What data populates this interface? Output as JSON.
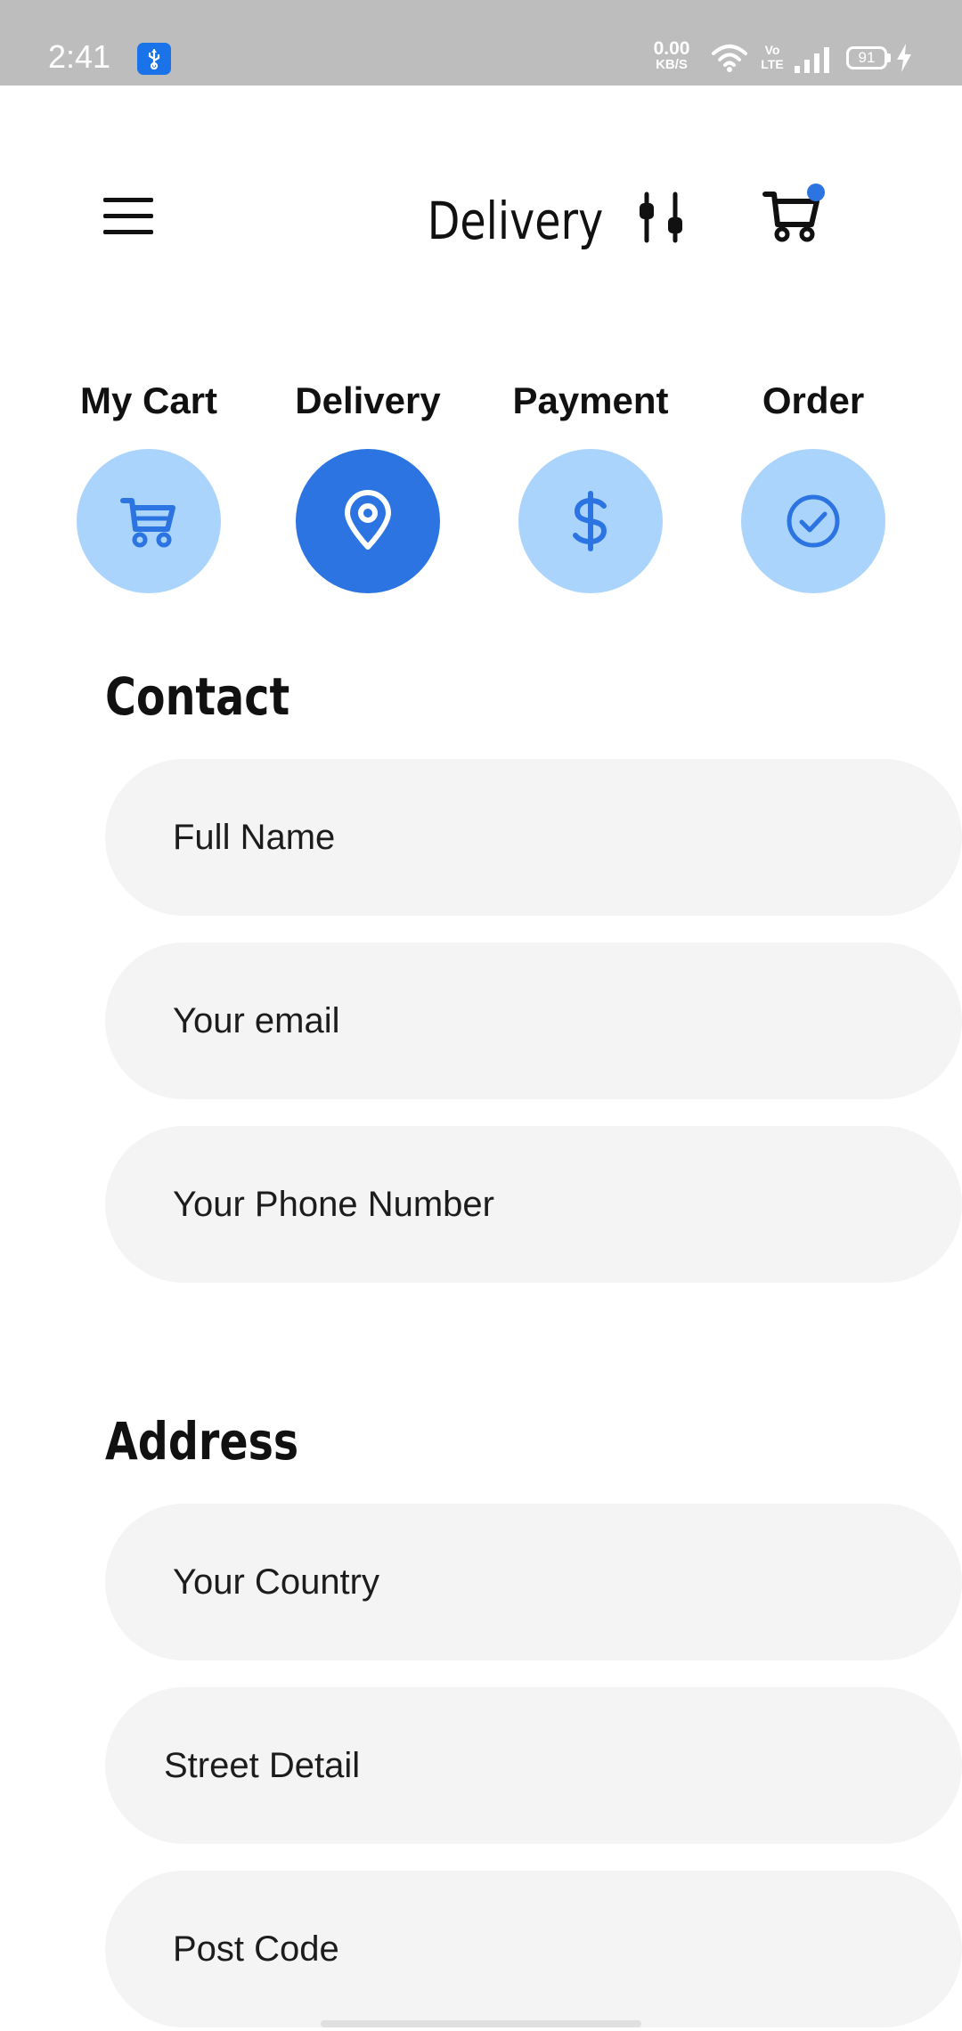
{
  "status_bar": {
    "time": "2:41",
    "net_speed_value": "0.00",
    "net_speed_unit": "KB/S",
    "volte_label": "Vo LTE",
    "battery_level": "91"
  },
  "app_bar": {
    "title": "Delivery",
    "icons": [
      "menu-icon",
      "filter-icon",
      "cart-icon"
    ],
    "cart_badge_color": "#2b74e2"
  },
  "steps": [
    {
      "label": "My Cart",
      "icon": "cart-icon",
      "active": false
    },
    {
      "label": "Delivery",
      "icon": "location-pin-icon",
      "active": true
    },
    {
      "label": "Payment",
      "icon": "dollar-icon",
      "active": false
    },
    {
      "label": "Order",
      "icon": "check-circle-icon",
      "active": false
    }
  ],
  "colors": {
    "accent": "#2b74e2",
    "step_inactive": "#aad4fb",
    "field_background": "#f4f4f4",
    "status_bar": "#bdbdbd"
  },
  "contact": {
    "title": "Contact",
    "fields": [
      {
        "placeholder": "Full Name",
        "value": ""
      },
      {
        "placeholder": "Your email",
        "value": ""
      },
      {
        "placeholder": "Your Phone Number",
        "value": ""
      }
    ]
  },
  "address": {
    "title": "Address",
    "fields": [
      {
        "placeholder": "Your Country",
        "value": ""
      },
      {
        "placeholder": "Street Detail",
        "value": ""
      },
      {
        "placeholder": "Post Code",
        "value": ""
      }
    ]
  }
}
